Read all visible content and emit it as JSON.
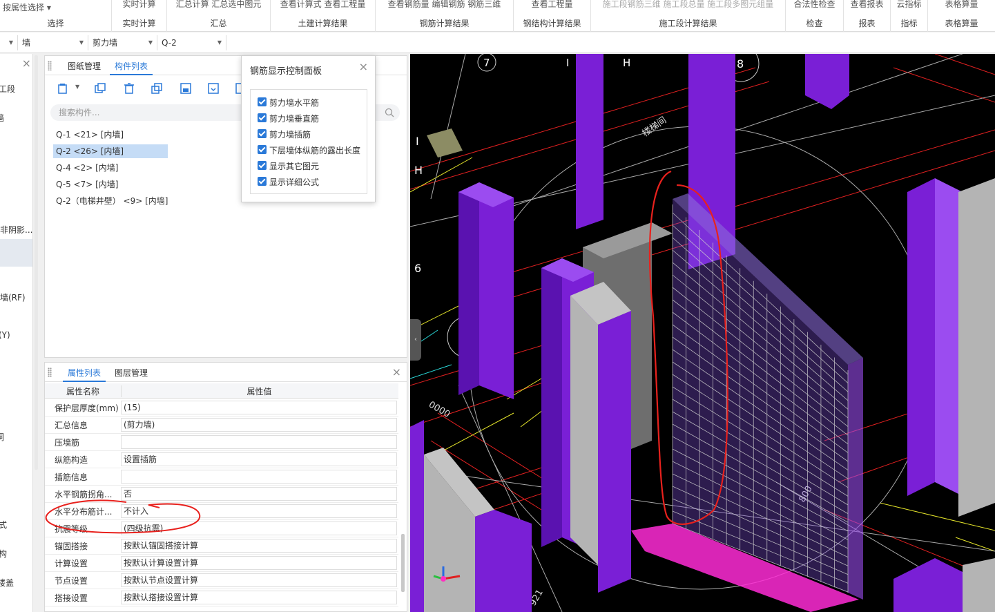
{
  "ribbon": {
    "groups": [
      {
        "top": "按属性选择 ▾",
        "label": "选择"
      },
      {
        "top": "实时计算",
        "label": "实时计算"
      },
      {
        "top": "汇总计算  汇总选中图元",
        "label": "汇总"
      },
      {
        "top": "查看计算式  查看工程量",
        "label": "土建计算结果"
      },
      {
        "top": "查看钢筋量  编辑钢筋  钢筋三维",
        "label": "钢筋计算结果"
      },
      {
        "top": "查看工程量",
        "label": "钢结构计算结果"
      },
      {
        "top": "施工段钢筋三维  施工段总量  施工段多图元组量",
        "label": "施工段计算结果"
      },
      {
        "top": "合法性检查",
        "label": "检查"
      },
      {
        "top": "查看报表",
        "label": "报表"
      },
      {
        "top": "云指标",
        "label": "指标"
      },
      {
        "top": "表格算量",
        "label": "表格算量"
      }
    ]
  },
  "selectors": {
    "s0": "",
    "s1": "墙",
    "s2": "剪力墙",
    "s3": "Q-2"
  },
  "left_strip": [
    "工段",
    "墙",
    ")",
    ")",
    "非阴影...",
    ")",
    "墙(RF)",
    ")",
    "(Y)",
    ")",
    "洞",
    "式",
    "构",
    "楼盖"
  ],
  "component_panel": {
    "tabs": [
      "图纸管理",
      "构件列表"
    ],
    "search_placeholder": "搜索构件...",
    "components": [
      "Q-1 <21> [内墙]",
      "Q-2 <26> [内墙]",
      "Q-4 <2> [内墙]",
      "Q-5 <7> [内墙]",
      "Q-2（电梯井壁） <9> [内墙]"
    ]
  },
  "rebar_popup": {
    "title": "钢筋显示控制面板",
    "options": [
      "剪力墙水平筋",
      "剪力墙垂直筋",
      "剪力墙插筋",
      "下层墙体纵筋的露出长度",
      "显示其它图元",
      "显示详细公式"
    ]
  },
  "property_panel": {
    "tabs": [
      "属性列表",
      "图层管理"
    ],
    "header_name": "属性名称",
    "header_value": "属性值",
    "rows": [
      {
        "name": "保护层厚度(mm)",
        "value": "(15)"
      },
      {
        "name": "汇总信息",
        "value": "(剪力墙)"
      },
      {
        "name": "压墙筋",
        "value": ""
      },
      {
        "name": "纵筋构造",
        "value": "设置插筋"
      },
      {
        "name": "插筋信息",
        "value": ""
      },
      {
        "name": "水平钢筋拐角...",
        "value": "否"
      },
      {
        "name": "水平分布筋计...",
        "value": "不计入"
      },
      {
        "name": "抗震等级",
        "value": "(四级抗震)"
      },
      {
        "name": "锚固搭接",
        "value": "按默认锚固搭接计算"
      },
      {
        "name": "计算设置",
        "value": "按默认计算设置计算"
      },
      {
        "name": "节点设置",
        "value": "按默认节点设置计算"
      },
      {
        "name": "搭接设置",
        "value": "按默认搭接设置计算"
      }
    ]
  },
  "viewport": {
    "axis_labels": [
      "7",
      "I",
      "H",
      "8",
      "I",
      "H",
      "6"
    ],
    "room_label": "楼梯间",
    "dims": [
      "0000",
      "800",
      "921"
    ],
    "colors": {
      "column": "#7a1fd6",
      "grey_wall": "#b4b4b4",
      "rebar": "#d0d0d0",
      "red_line": "#e02020",
      "yellow_line": "#e5e52a",
      "magenta": "#ff2bd6",
      "annotation": "#e8211d"
    }
  }
}
